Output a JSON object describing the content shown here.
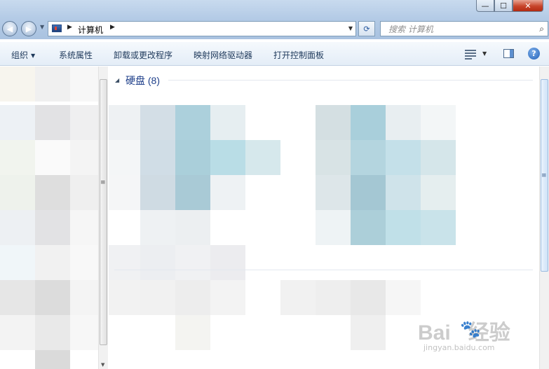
{
  "window": {
    "controls": {
      "minimize_glyph": "—",
      "maximize_glyph": "☐",
      "close_glyph": "✕"
    }
  },
  "address_bar": {
    "back_glyph": "◀",
    "forward_glyph": "▶",
    "breadcrumb": "计算机",
    "refresh_glyph": "⟳"
  },
  "search": {
    "placeholder": "搜索 计算机",
    "icon": "search-icon"
  },
  "toolbar": {
    "organize": "组织",
    "items": [
      "系统属性",
      "卸载或更改程序",
      "映射网络驱动器",
      "打开控制面板"
    ],
    "help_glyph": "?"
  },
  "content": {
    "group_header": "硬盘 (8)"
  },
  "watermark": {
    "logo": "Bai",
    "logo2": "经验",
    "sub": "jingyan.baidu.com"
  },
  "colors": {
    "accent": "#1e3f8a",
    "titlebar": "#b4cbe6",
    "tile_blue": "#a9cfdb"
  }
}
